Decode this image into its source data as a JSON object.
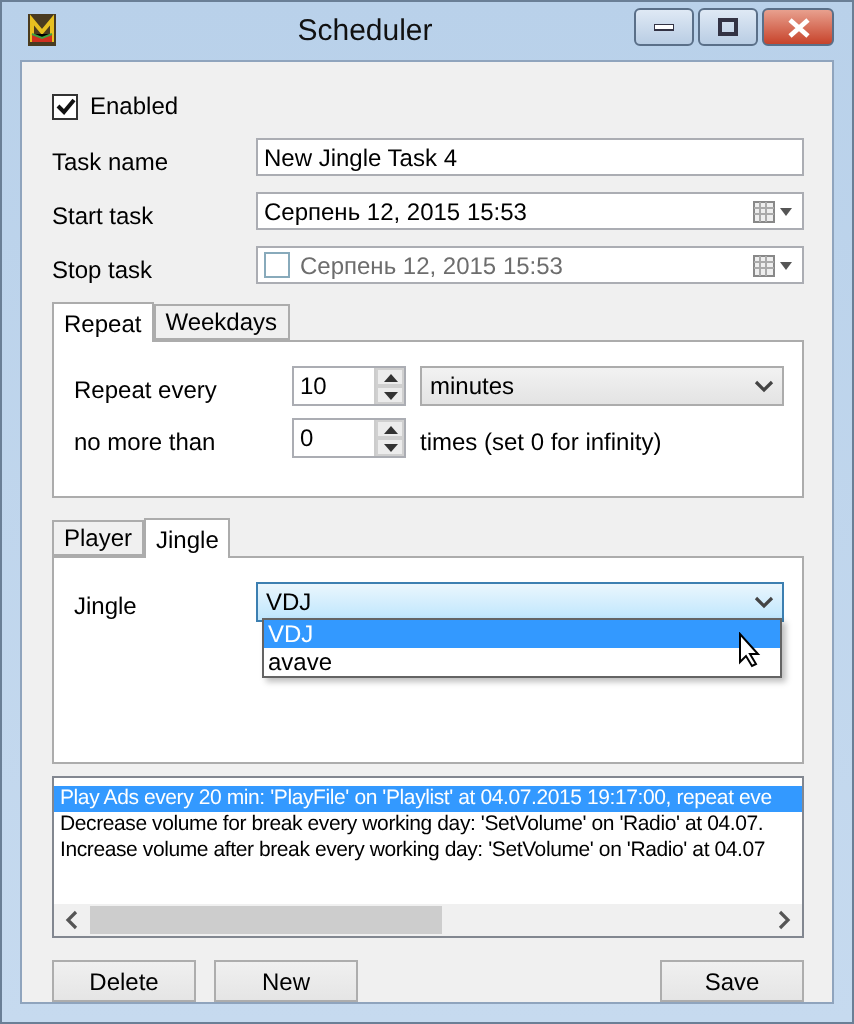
{
  "window": {
    "title": "Scheduler"
  },
  "enabled": {
    "label": "Enabled",
    "checked": true
  },
  "fields": [
    {
      "kind": "text",
      "label": "Task name",
      "value": "New Jingle Task 4"
    },
    {
      "kind": "date",
      "label": "Start task",
      "value": "Серпень  12, 2015 15:53",
      "disabled": false
    },
    {
      "kind": "date",
      "label": "Stop task",
      "value": "Серпень  12, 2015 15:53",
      "disabled": true,
      "checked": false
    }
  ],
  "repeat_tabs": [
    {
      "label": "Repeat",
      "selected": true
    },
    {
      "label": "Weekdays",
      "selected": false
    }
  ],
  "repeat": {
    "every_label": "Repeat every",
    "every_value": "10",
    "unit": "minutes",
    "limit_label": "no more than",
    "limit_value": "0",
    "limit_hint": "times (set 0 for infinity)"
  },
  "action_tabs": [
    {
      "label": "Player",
      "selected": false
    },
    {
      "label": "Jingle",
      "selected": true
    }
  ],
  "jingle": {
    "label": "Jingle",
    "value": "VDJ",
    "open": true,
    "options": [
      {
        "label": "VDJ",
        "selected": true
      },
      {
        "label": "avave",
        "selected": false
      }
    ]
  },
  "tasks": [
    {
      "text": "Play Ads every 20 min: 'PlayFile' on 'Playlist' at 04.07.2015 19:17:00, repeat eve",
      "selected": true
    },
    {
      "text": "Decrease volume for break every working day: 'SetVolume' on 'Radio' at 04.07.",
      "selected": false
    },
    {
      "text": "Increase volume after break every working day: 'SetVolume' on 'Radio' at 04.07",
      "selected": false
    }
  ],
  "buttons_left": [
    {
      "label": "Delete"
    },
    {
      "label": "New"
    }
  ],
  "buttons_right": [
    {
      "label": "Save"
    }
  ]
}
